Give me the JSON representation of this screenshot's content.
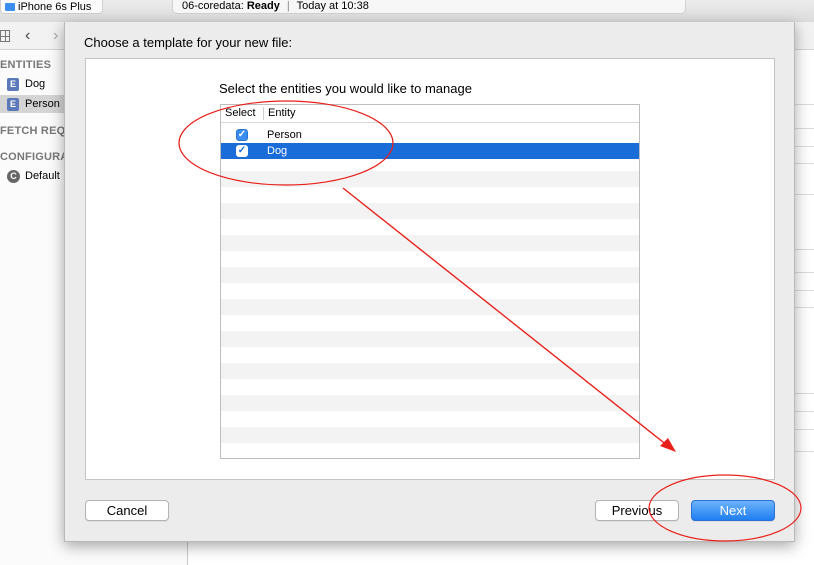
{
  "toolbar": {
    "device": "iPhone 6s Plus",
    "activity_project": "06-coredata:",
    "activity_status": "Ready",
    "activity_separator": "|",
    "activity_time": "Today at 10:38"
  },
  "sidebar": {
    "entities_header": "ENTITIES",
    "entities": [
      {
        "badge": "E",
        "label": "Dog"
      },
      {
        "badge": "E",
        "label": "Person"
      }
    ],
    "fetch_header": "FETCH REQ",
    "config_header": "CONFIGURA",
    "configs": [
      {
        "badge": "C",
        "label": "Default"
      }
    ]
  },
  "sheet": {
    "title": "Choose a template for your new file:",
    "prompt": "Select the entities you would like to manage",
    "columns": [
      "Select",
      "Entity"
    ],
    "rows": [
      {
        "checked": true,
        "check_glyph": "✓",
        "label": "Person"
      },
      {
        "checked": true,
        "check_glyph": "✓",
        "label": "Dog"
      }
    ],
    "selected_row": "Dog",
    "buttons": {
      "cancel": "Cancel",
      "previous": "Previous",
      "next": "Next"
    }
  },
  "colors": {
    "selection": "#1a6dd9",
    "accent": "#3b8ef0",
    "annotation": "#e8201a"
  },
  "icons": {
    "back": "‹",
    "forward": "›"
  }
}
